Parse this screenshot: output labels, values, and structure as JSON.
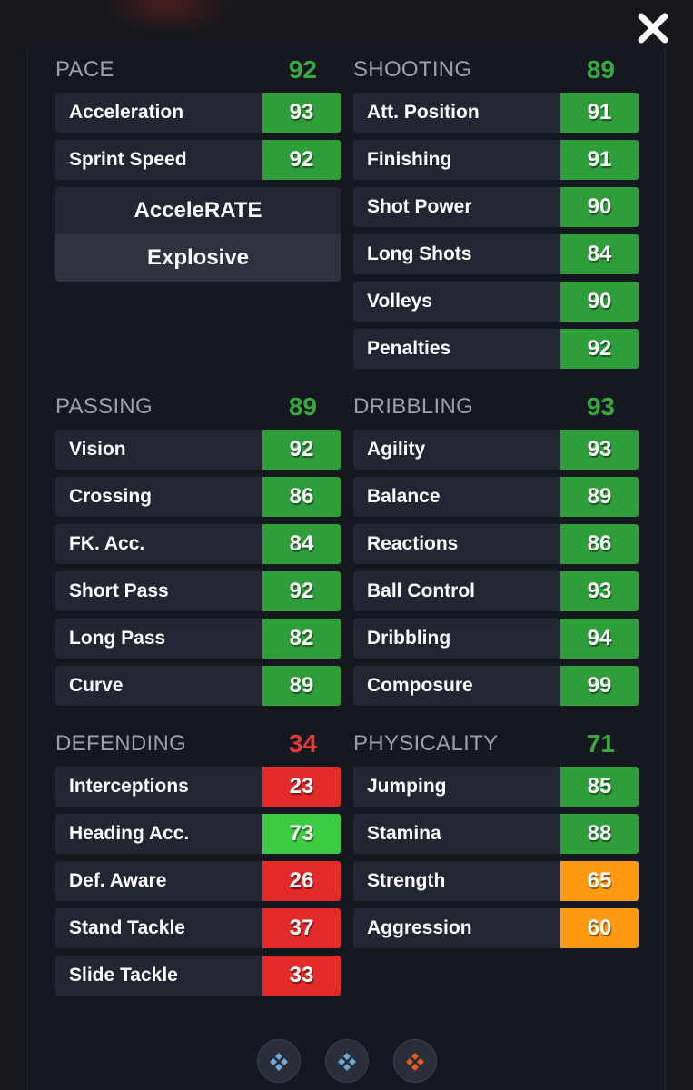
{
  "colors": {
    "green": "#2e9e3a",
    "bright_green": "#3fcc45",
    "red": "#e52a2a",
    "orange": "#ff9a12",
    "header_green": "#36a93f",
    "header_red": "#e53935",
    "nav_blue": "#6da8d8",
    "nav_orange": "#ea5a1e"
  },
  "groups": [
    {
      "title": "PACE",
      "value": "92",
      "value_color": "header_green",
      "stats": [
        {
          "label": "Acceleration",
          "value": "93",
          "color": "green"
        },
        {
          "label": "Sprint Speed",
          "value": "92",
          "color": "green"
        }
      ],
      "playstyles": [
        "AcceleRATE",
        "Explosive"
      ]
    },
    {
      "title": "SHOOTING",
      "value": "89",
      "value_color": "header_green",
      "stats": [
        {
          "label": "Att. Position",
          "value": "91",
          "color": "green"
        },
        {
          "label": "Finishing",
          "value": "91",
          "color": "green"
        },
        {
          "label": "Shot Power",
          "value": "90",
          "color": "green"
        },
        {
          "label": "Long Shots",
          "value": "84",
          "color": "green"
        },
        {
          "label": "Volleys",
          "value": "90",
          "color": "green"
        },
        {
          "label": "Penalties",
          "value": "92",
          "color": "green"
        }
      ]
    },
    {
      "title": "PASSING",
      "value": "89",
      "value_color": "header_green",
      "stats": [
        {
          "label": "Vision",
          "value": "92",
          "color": "green"
        },
        {
          "label": "Crossing",
          "value": "86",
          "color": "green"
        },
        {
          "label": "FK. Acc.",
          "value": "84",
          "color": "green"
        },
        {
          "label": "Short Pass",
          "value": "92",
          "color": "green"
        },
        {
          "label": "Long Pass",
          "value": "82",
          "color": "green"
        },
        {
          "label": "Curve",
          "value": "89",
          "color": "green"
        }
      ]
    },
    {
      "title": "DRIBBLING",
      "value": "93",
      "value_color": "header_green",
      "stats": [
        {
          "label": "Agility",
          "value": "93",
          "color": "green"
        },
        {
          "label": "Balance",
          "value": "89",
          "color": "green"
        },
        {
          "label": "Reactions",
          "value": "86",
          "color": "green"
        },
        {
          "label": "Ball Control",
          "value": "93",
          "color": "green"
        },
        {
          "label": "Dribbling",
          "value": "94",
          "color": "green"
        },
        {
          "label": "Composure",
          "value": "99",
          "color": "green"
        }
      ]
    },
    {
      "title": "DEFENDING",
      "value": "34",
      "value_color": "header_red",
      "stats": [
        {
          "label": "Interceptions",
          "value": "23",
          "color": "red"
        },
        {
          "label": "Heading Acc.",
          "value": "73",
          "color": "bright_green"
        },
        {
          "label": "Def. Aware",
          "value": "26",
          "color": "red"
        },
        {
          "label": "Stand Tackle",
          "value": "37",
          "color": "red"
        },
        {
          "label": "Slide Tackle",
          "value": "33",
          "color": "red"
        }
      ]
    },
    {
      "title": "PHYSICALITY",
      "value": "71",
      "value_color": "header_green",
      "stats": [
        {
          "label": "Jumping",
          "value": "85",
          "color": "green"
        },
        {
          "label": "Stamina",
          "value": "88",
          "color": "green"
        },
        {
          "label": "Strength",
          "value": "65",
          "color": "orange"
        },
        {
          "label": "Aggression",
          "value": "60",
          "color": "orange"
        }
      ]
    }
  ],
  "close_icon": "close-icon",
  "nav": [
    {
      "icon": "diamond-cluster-icon",
      "color": "nav_blue"
    },
    {
      "icon": "diamond-cluster-icon",
      "color": "nav_blue"
    },
    {
      "icon": "diamond-cluster-icon",
      "color": "nav_orange"
    }
  ]
}
